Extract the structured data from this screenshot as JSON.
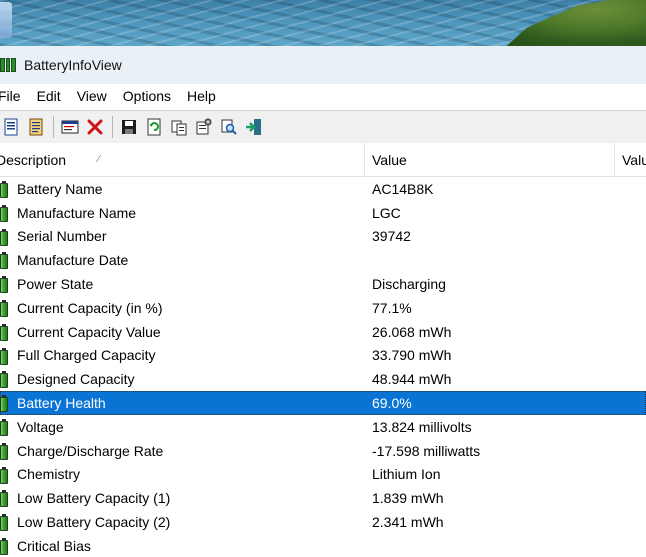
{
  "window": {
    "title": "BatteryInfoView"
  },
  "menu": [
    "File",
    "Edit",
    "View",
    "Options",
    "Help"
  ],
  "toolbar": {
    "buttons": [
      {
        "icon": "html-report-icon"
      },
      {
        "icon": "text-report-icon"
      },
      {
        "icon": "properties-window-icon"
      },
      {
        "icon": "delete-icon"
      },
      {
        "icon": "save-icon"
      },
      {
        "icon": "refresh-icon"
      },
      {
        "icon": "copy-icon"
      },
      {
        "icon": "options-icon"
      },
      {
        "icon": "find-icon"
      },
      {
        "icon": "exit-icon"
      }
    ]
  },
  "columns": {
    "description": "Description",
    "value": "Value",
    "value2": "Valu"
  },
  "rows": [
    {
      "description": "Battery Name",
      "value": "AC14B8K"
    },
    {
      "description": "Manufacture Name",
      "value": "LGC"
    },
    {
      "description": "Serial Number",
      "value": "39742"
    },
    {
      "description": "Manufacture Date",
      "value": ""
    },
    {
      "description": "Power State",
      "value": "Discharging"
    },
    {
      "description": "Current Capacity (in %)",
      "value": "77.1%"
    },
    {
      "description": "Current Capacity Value",
      "value": "26.068 mWh"
    },
    {
      "description": "Full Charged Capacity",
      "value": "33.790 mWh"
    },
    {
      "description": "Designed Capacity",
      "value": "48.944 mWh"
    },
    {
      "description": "Battery Health",
      "value": "69.0%",
      "selected": true
    },
    {
      "description": "Voltage",
      "value": "13.824 millivolts"
    },
    {
      "description": "Charge/Discharge Rate",
      "value": "-17.598 milliwatts"
    },
    {
      "description": "Chemistry",
      "value": "Lithium Ion"
    },
    {
      "description": "Low Battery Capacity (1)",
      "value": "1.839 mWh"
    },
    {
      "description": "Low Battery Capacity (2)",
      "value": "2.341 mWh"
    },
    {
      "description": "Critical Bias",
      "value": ""
    }
  ],
  "colors": {
    "selection": "#0a74d4",
    "titlebar": "#e9f1f7"
  }
}
